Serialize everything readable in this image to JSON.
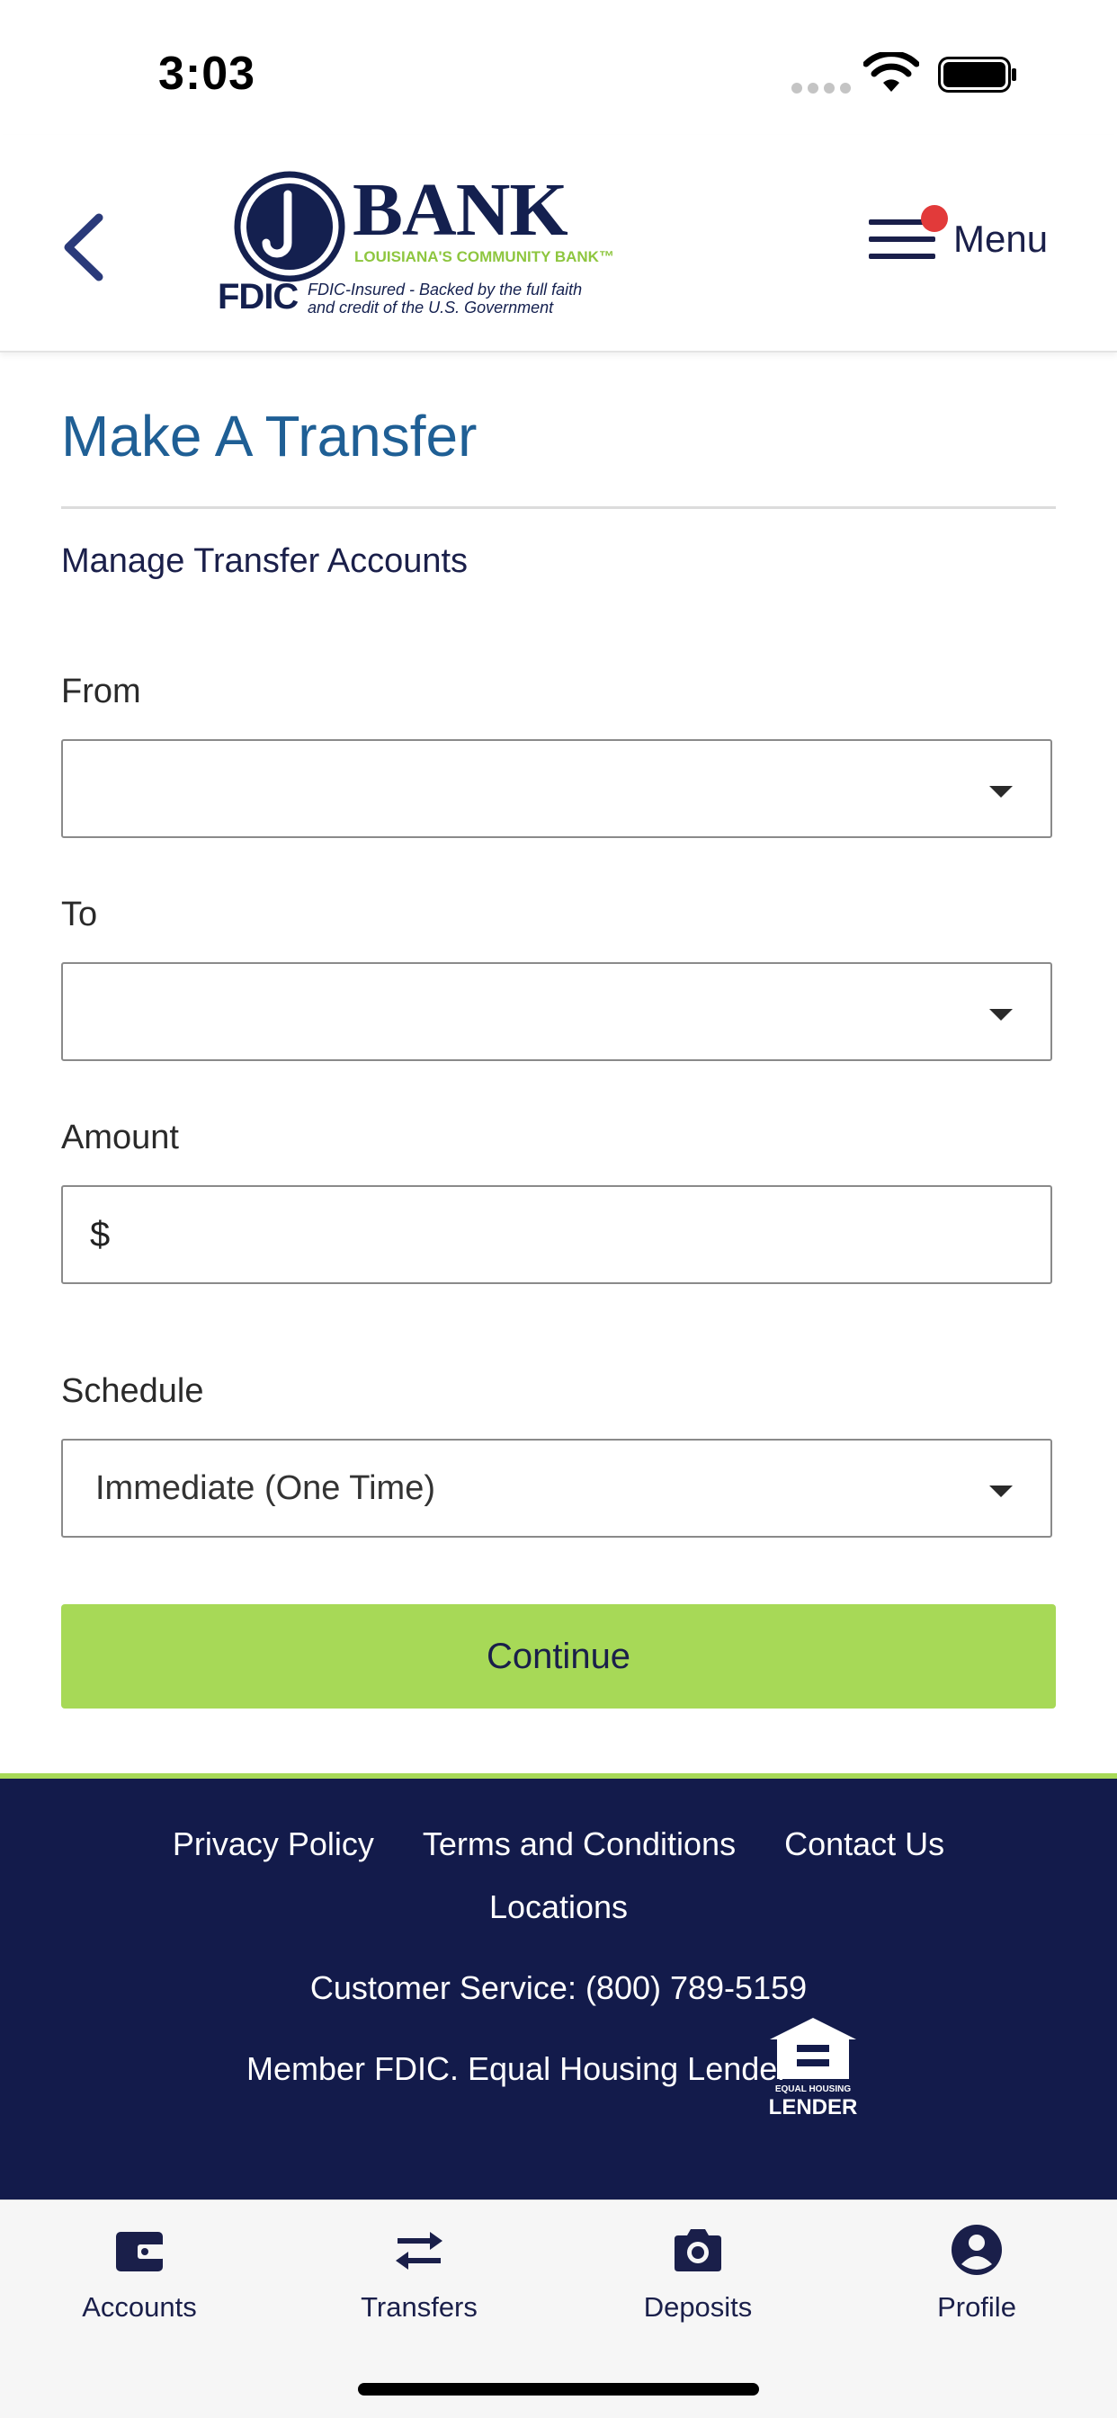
{
  "status_bar": {
    "time": "3:03"
  },
  "header": {
    "back_icon": "chevron-left-icon",
    "logo": {
      "brand": "BANK",
      "tagline": "LOUISIANA'S COMMUNITY BANK™",
      "fdic": "FDIC",
      "fdic_note_line1": "FDIC-Insured - Backed by the full faith",
      "fdic_note_line2": "and credit of the U.S. Government"
    },
    "menu_label": "Menu",
    "menu_notification_color": "#e23a3a"
  },
  "page": {
    "title": "Make A Transfer",
    "manage_link": "Manage Transfer Accounts",
    "from": {
      "label": "From",
      "value": ""
    },
    "to": {
      "label": "To",
      "value": ""
    },
    "amount": {
      "label": "Amount",
      "currency_symbol": "$",
      "value": ""
    },
    "schedule": {
      "label": "Schedule",
      "value": "Immediate (One Time)"
    },
    "continue_label": "Continue"
  },
  "footer": {
    "links": [
      "Privacy Policy",
      "Terms and Conditions",
      "Contact Us"
    ],
    "locations": "Locations",
    "customer_service": "Customer Service: (800) 789-5159",
    "member": "Member FDIC. Equal Housing Lender",
    "ehl_line1": "EQUAL HOUSING",
    "ehl_line2": "LENDER"
  },
  "tabbar": {
    "tabs": [
      {
        "label": "Accounts",
        "icon": "wallet-icon"
      },
      {
        "label": "Transfers",
        "icon": "transfer-arrows-icon"
      },
      {
        "label": "Deposits",
        "icon": "camera-icon"
      },
      {
        "label": "Profile",
        "icon": "person-circle-icon"
      }
    ]
  },
  "colors": {
    "navy": "#131b4b",
    "title_blue": "#1f5f95",
    "accent_green": "#a7d957"
  }
}
